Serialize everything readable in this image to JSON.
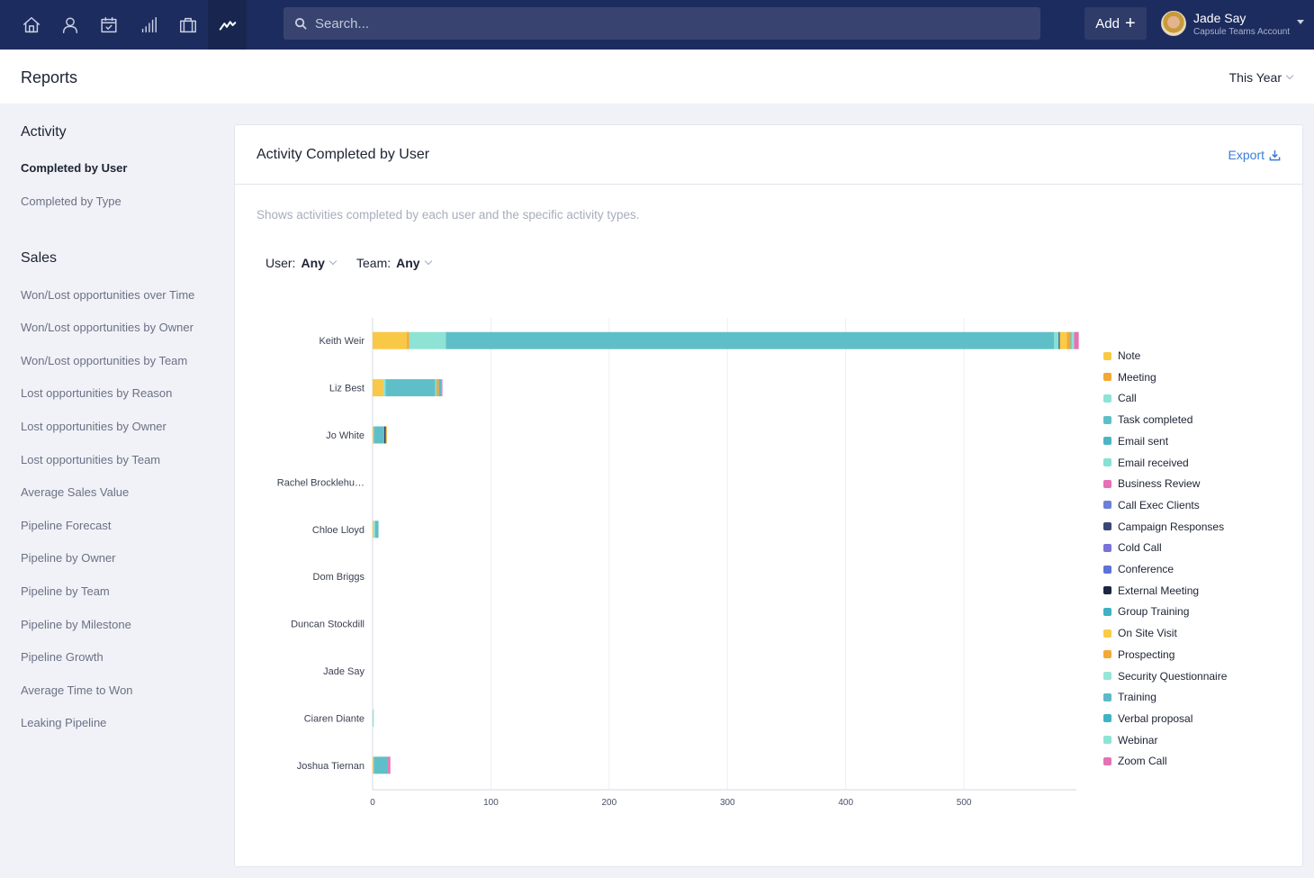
{
  "nav": {
    "icons": [
      "home-icon",
      "person-icon",
      "calendar-icon",
      "signal-bars-icon",
      "briefcase-icon",
      "reports-trend-icon"
    ],
    "active": "reports-trend-icon",
    "tooltip": "Reports",
    "search_placeholder": "Search...",
    "add_label": "Add",
    "user_name": "Jade Say",
    "user_account": "Capsule Teams Account"
  },
  "header": {
    "title": "Reports",
    "period": "This Year"
  },
  "sidebar": {
    "sections": [
      {
        "heading": "Activity",
        "items": [
          {
            "label": "Completed by User",
            "active": true
          },
          {
            "label": "Completed by Type",
            "active": false
          }
        ]
      },
      {
        "heading": "Sales",
        "items": [
          {
            "label": "Won/Lost opportunities over Time"
          },
          {
            "label": "Won/Lost opportunities by Owner"
          },
          {
            "label": "Won/Lost opportunities by Team"
          },
          {
            "label": "Lost opportunities by Reason"
          },
          {
            "label": "Lost opportunities by Owner"
          },
          {
            "label": "Lost opportunities by Team"
          },
          {
            "label": "Average Sales Value"
          },
          {
            "label": "Pipeline Forecast"
          },
          {
            "label": "Pipeline by Owner"
          },
          {
            "label": "Pipeline by Team"
          },
          {
            "label": "Pipeline by Milestone"
          },
          {
            "label": "Pipeline Growth"
          },
          {
            "label": "Average Time to Won"
          },
          {
            "label": "Leaking Pipeline"
          }
        ]
      }
    ]
  },
  "card": {
    "title": "Activity Completed by User",
    "export_label": "Export",
    "description": "Shows activities completed by each user and the specific activity types.",
    "filters": [
      {
        "label": "User:",
        "value": "Any"
      },
      {
        "label": "Team:",
        "value": "Any"
      }
    ]
  },
  "chart_data": {
    "type": "bar",
    "orientation": "horizontal",
    "stacked": true,
    "title": "Activity Completed by User",
    "xlabel": "",
    "ylabel": "",
    "xlim": [
      0,
      595
    ],
    "xticks": [
      0,
      100,
      200,
      300,
      400,
      500
    ],
    "grid": true,
    "legend_position": "right",
    "categories": [
      "Keith Weir",
      "Liz Best",
      "Jo White",
      "Rachel Brocklehu…",
      "Chloe Lloyd",
      "Dom Briggs",
      "Duncan Stockdill",
      "Jade Say",
      "Ciaren Diante",
      "Joshua Tiernan"
    ],
    "series": [
      {
        "name": "Note",
        "color": "#f9c846",
        "values": [
          29,
          9,
          1,
          0,
          1,
          0,
          0,
          0,
          0,
          1
        ]
      },
      {
        "name": "Meeting",
        "color": "#f3a833",
        "values": [
          2,
          0,
          0,
          0,
          0,
          0,
          0,
          0,
          0,
          0
        ]
      },
      {
        "name": "Call",
        "color": "#8ee3d5",
        "values": [
          31,
          2,
          0,
          0,
          1,
          0,
          0,
          0,
          1,
          0
        ]
      },
      {
        "name": "Task completed",
        "color": "#5fbfc8",
        "values": [
          514,
          42,
          9,
          0,
          3,
          0,
          0,
          0,
          0,
          12
        ]
      },
      {
        "name": "Email sent",
        "color": "#4bb5c4",
        "values": [
          0,
          0,
          0,
          0,
          0,
          0,
          0,
          0,
          0,
          0
        ]
      },
      {
        "name": "Email received",
        "color": "#86e0d4",
        "values": [
          4,
          1,
          0,
          0,
          0,
          0,
          0,
          0,
          0,
          0
        ]
      },
      {
        "name": "Business Review",
        "color": "#e76fb5",
        "values": [
          0,
          0,
          0,
          0,
          0,
          0,
          0,
          0,
          0,
          0
        ]
      },
      {
        "name": "Call Exec Clients",
        "color": "#6d7fd6",
        "values": [
          0,
          0,
          0,
          0,
          0,
          0,
          0,
          0,
          0,
          0
        ]
      },
      {
        "name": "Campaign Responses",
        "color": "#3b4677",
        "values": [
          1,
          0,
          0,
          0,
          0,
          0,
          0,
          0,
          0,
          0
        ]
      },
      {
        "name": "Cold Call",
        "color": "#7a72d8",
        "values": [
          0,
          0,
          0,
          0,
          0,
          0,
          0,
          0,
          0,
          0
        ]
      },
      {
        "name": "Conference",
        "color": "#5f72d6",
        "values": [
          0,
          0,
          0,
          0,
          0,
          0,
          0,
          0,
          0,
          0
        ]
      },
      {
        "name": "External Meeting",
        "color": "#1c2541",
        "values": [
          0,
          0,
          1,
          0,
          0,
          0,
          0,
          0,
          0,
          0
        ]
      },
      {
        "name": "Group Training",
        "color": "#3fb1c2",
        "values": [
          0,
          0,
          0,
          0,
          0,
          0,
          0,
          0,
          0,
          0
        ]
      },
      {
        "name": "On Site Visit",
        "color": "#fbcb45",
        "values": [
          6,
          0,
          0,
          0,
          0,
          0,
          0,
          0,
          0,
          0
        ]
      },
      {
        "name": "Prospecting",
        "color": "#f2a935",
        "values": [
          3,
          2,
          1,
          0,
          0,
          0,
          0,
          0,
          0,
          0
        ]
      },
      {
        "name": "Security Questionnaire",
        "color": "#94e6d8",
        "values": [
          0,
          0,
          0,
          0,
          0,
          0,
          0,
          0,
          0,
          0
        ]
      },
      {
        "name": "Training",
        "color": "#5cbac6",
        "values": [
          1,
          2,
          0,
          0,
          0,
          0,
          0,
          0,
          0,
          0
        ]
      },
      {
        "name": "Verbal proposal",
        "color": "#40b3c3",
        "values": [
          0,
          0,
          0,
          0,
          0,
          0,
          0,
          0,
          0,
          0
        ]
      },
      {
        "name": "Webinar",
        "color": "#8de3d6",
        "values": [
          2,
          0,
          0,
          0,
          0,
          0,
          0,
          0,
          0,
          0
        ]
      },
      {
        "name": "Zoom Call",
        "color": "#e473b3",
        "values": [
          4,
          1,
          0,
          0,
          0,
          0,
          0,
          0,
          0,
          2
        ]
      }
    ]
  }
}
